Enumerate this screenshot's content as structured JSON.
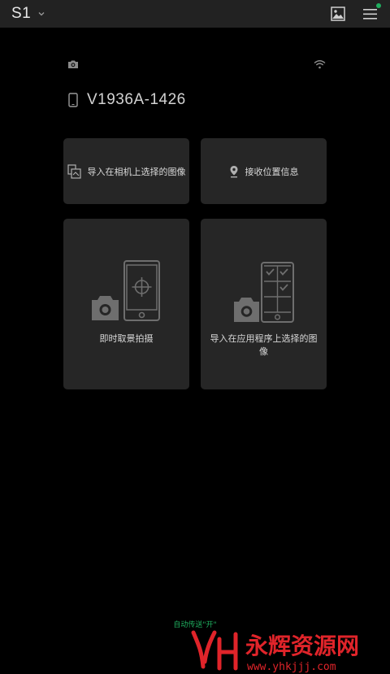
{
  "header": {
    "model_name": "S1",
    "gallery_icon": "gallery-icon",
    "menu_icon": "hamburger-menu-icon"
  },
  "status": {
    "camera_icon": "camera-icon",
    "wifi_icon": "wifi-icon"
  },
  "device": {
    "name": "V1936A-1426"
  },
  "actions": {
    "import_camera_selected": "导入在相机上选择的图像",
    "receive_location": "接收位置信息",
    "remote_shooting": "即时取景拍摄",
    "import_app_selected": "导入在应用程序上选择的图像"
  },
  "footer": {
    "auto_transfer": "自动传送\"开\""
  },
  "watermark": {
    "brand": "永辉资源网",
    "url": "www.yhkjjj.com"
  },
  "colors": {
    "background": "#000000",
    "topbar": "#222222",
    "card": "#262626",
    "accent_green": "#1fae5f",
    "icon_gray": "#8a8a8a",
    "watermark_red": "#e0242a"
  }
}
